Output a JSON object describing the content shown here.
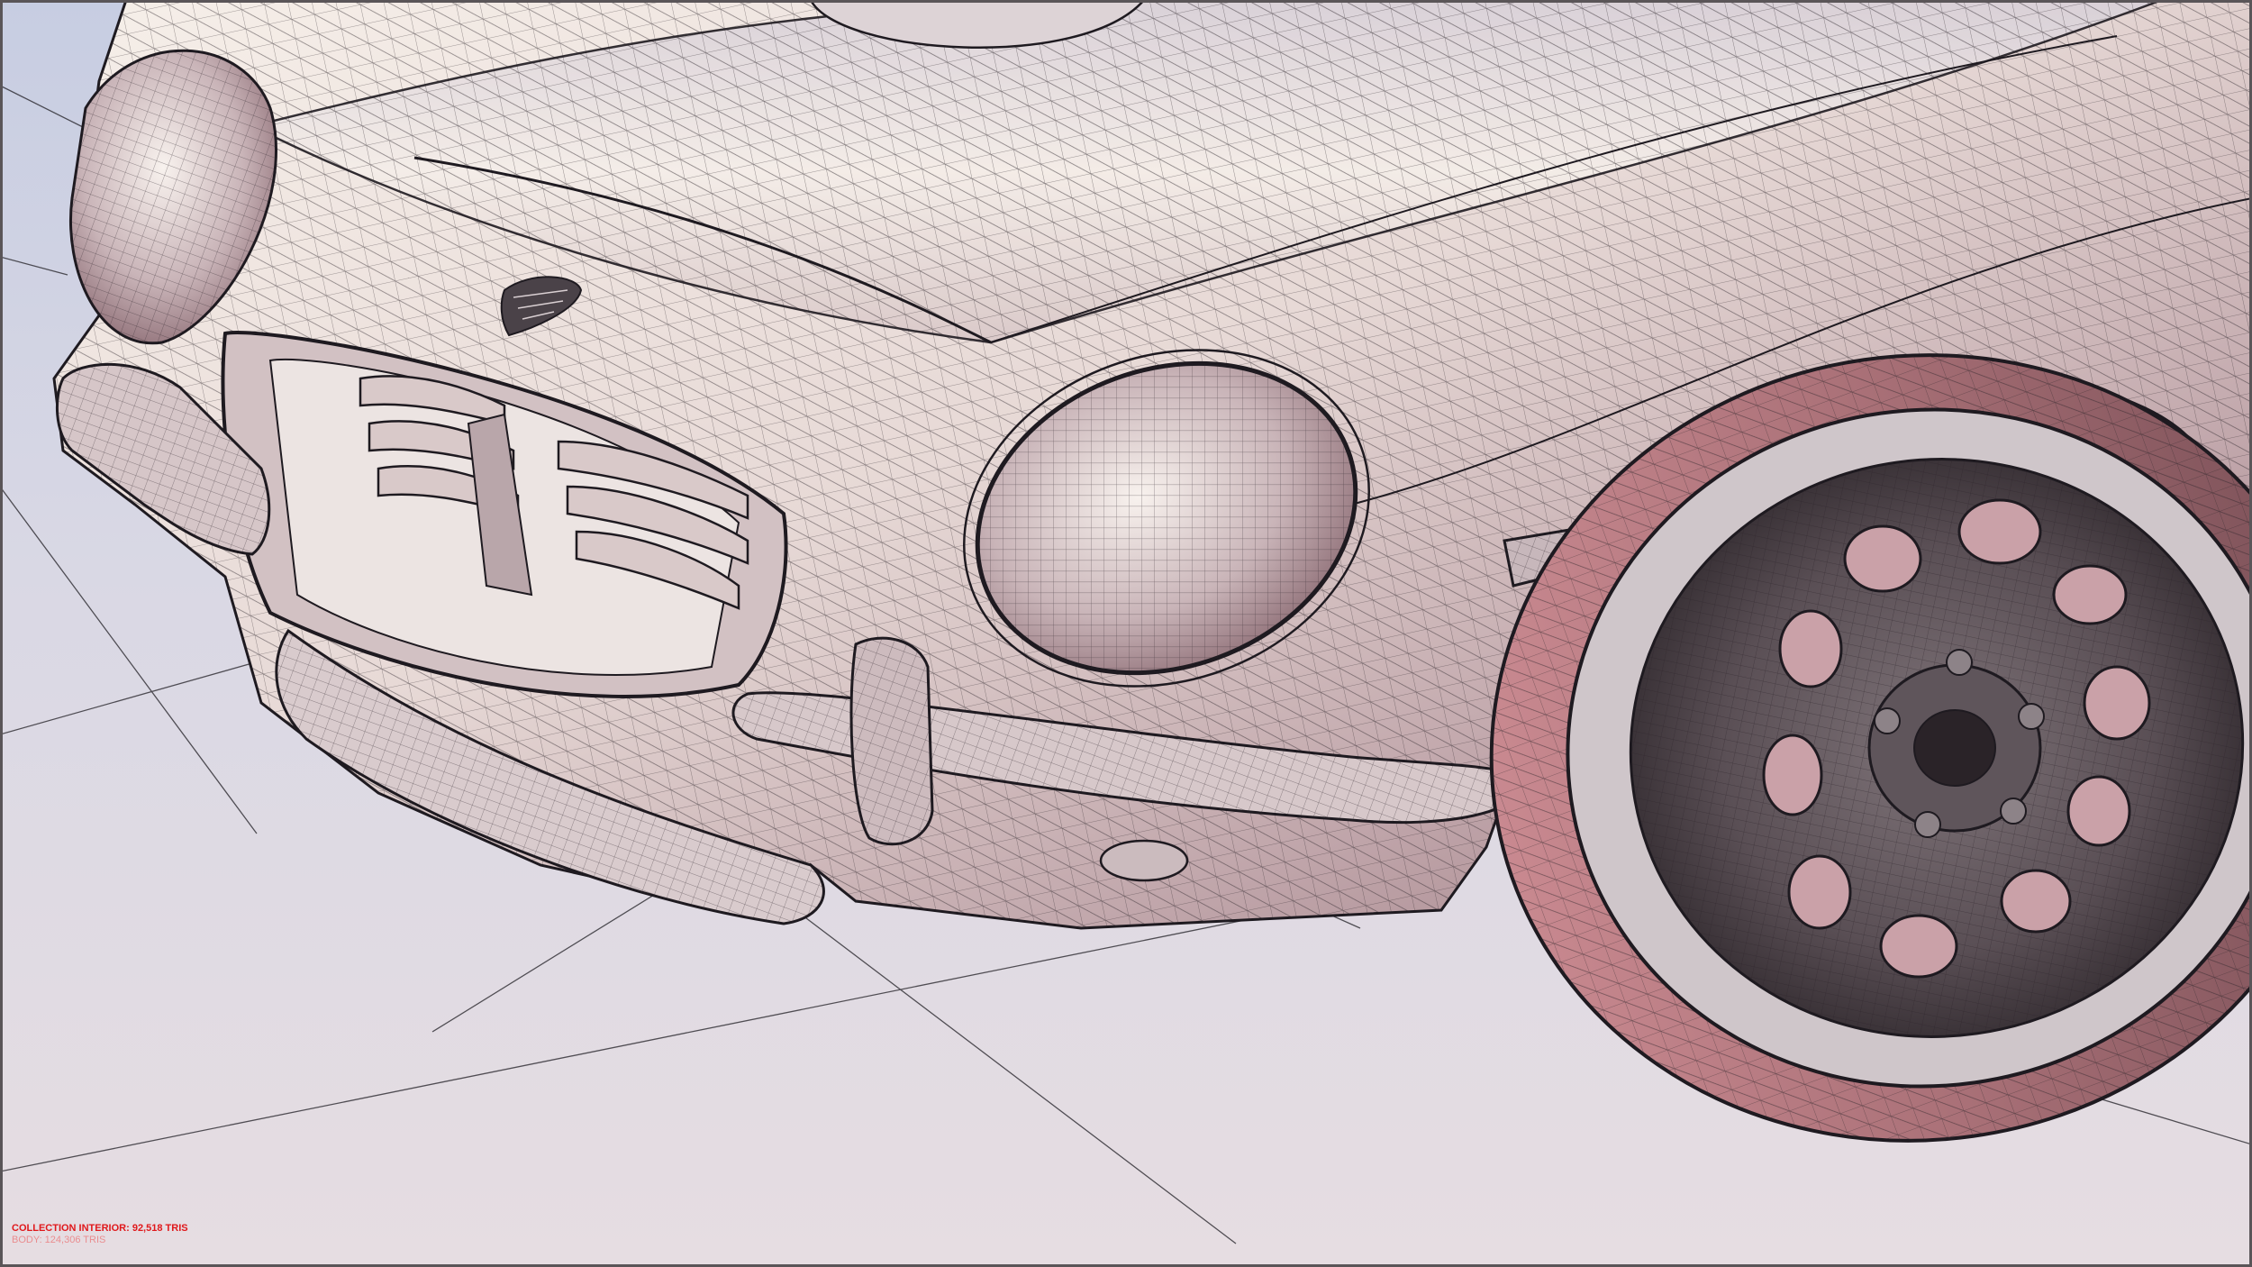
{
  "viewport": {
    "title": "",
    "colors": {
      "background_top": "#c7cde2",
      "background_bottom": "#e6dde2",
      "body_light": "#f4ece8",
      "body_mid": "#cdbdbf",
      "body_shadow": "#9c7a80",
      "wire": "#1e1a20",
      "tire": "#b87a80",
      "stats_text": "#e0181b"
    },
    "scene": {
      "subject": "wireframe-shaded car model front three-quarter view",
      "icons": [
        "car-badge-icon"
      ]
    }
  },
  "overlay": {
    "stats_primary": "COLLECTION INTERIOR: 92,518 TRIS",
    "stats_secondary": "BODY: 124,306 TRIS"
  }
}
